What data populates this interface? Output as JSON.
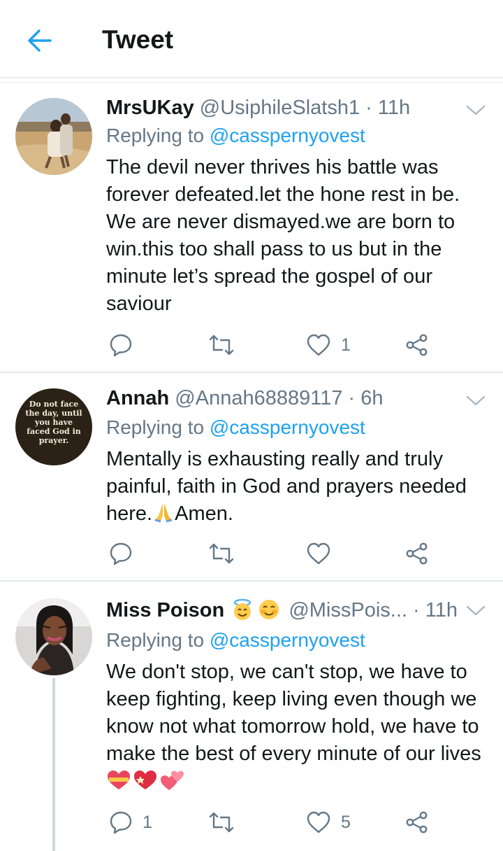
{
  "header": {
    "title": "Tweet"
  },
  "tweets": [
    {
      "name": "MrsUKay",
      "handle": "@UsiphileSlatsh1",
      "time": "· 11h",
      "reply_prefix": "Replying to",
      "reply_handle": "@casspernyovest",
      "text": "The devil never thrives his battle was forever defeated.let the hone rest in be. We are never dismayed.we are born to win.this too shall pass to us but in the minute let’s spread the gospel of our saviour",
      "replies": "",
      "retweets": "",
      "likes": "1"
    },
    {
      "name": "Annah",
      "handle": "@Annah68889117",
      "time": "· 6h",
      "reply_prefix": "Replying to",
      "reply_handle": "@casspernyovest",
      "text_before": "Mentally is exhausting really and truly painful, faith in God and prayers needed here.",
      "text_after": "Amen.",
      "avatar_text": "Do not face the day, until you have faced God in prayer.",
      "replies": "",
      "retweets": "",
      "likes": ""
    },
    {
      "name": "Miss Poison",
      "handle": "@MissPois...",
      "time": "· 11h",
      "reply_prefix": "Replying to",
      "reply_handle": "@casspernyovest",
      "text": "We don't stop, we can't stop, we have to keep fighting, keep living even though we know not what tomorrow hold, we have to make the best of every minute of our lives",
      "replies": "1",
      "retweets": "",
      "likes": "5"
    }
  ],
  "colors": {
    "accent": "#1da1f2",
    "secondary_text": "#657786",
    "divider": "#e1e8ed"
  }
}
